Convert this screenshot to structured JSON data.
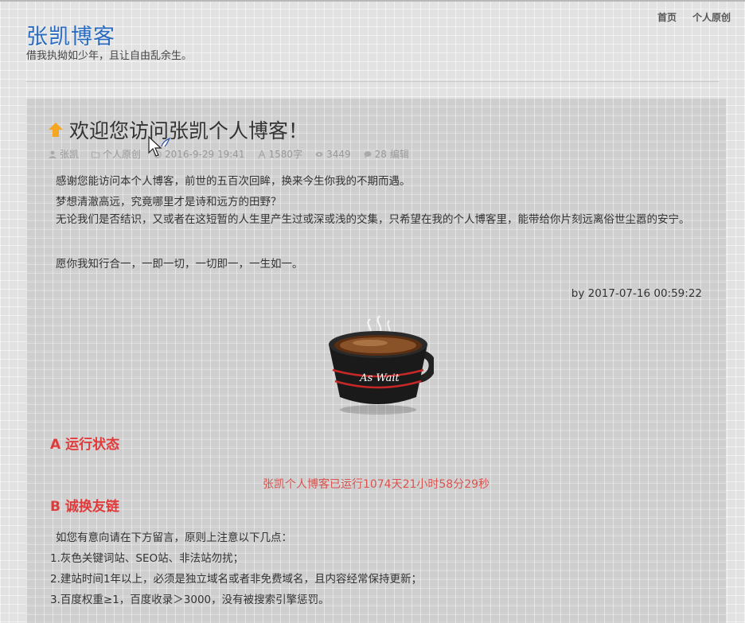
{
  "site": {
    "title": "张凯博客",
    "tagline": "借我执拗如少年，且让自由乱余生。"
  },
  "nav": {
    "items": [
      "首页",
      "个人原创"
    ]
  },
  "post": {
    "title": "欢迎您访问张凯个人博客！",
    "meta": {
      "author": "张凯",
      "category": "个人原创",
      "date": "2016-9-29 19:41",
      "words": "1580字",
      "views": "3449",
      "comments": "28",
      "edit": "编辑"
    },
    "paragraphs": [
      "感谢您能访问本个人博客，前世的五百次回眸，换来今生你我的不期而遇。",
      "梦想清澈高远，究竟哪里才是诗和远方的田野？",
      "无论我们是否结识，又或者在这短暂的人生里产生过或深或浅的交集，只希望在我的个人博客里，能带给你片刻远离俗世尘嚣的安宁。",
      "愿你我知行合一，一即一切，一切即一，一生如一。"
    ],
    "byline": "by 2017-07-16 00:59:22",
    "cup_text": "As Wait"
  },
  "section_a": {
    "heading": "A 运行状态",
    "runtime": "张凯个人博客已运行1074天21小时58分29秒"
  },
  "section_b": {
    "heading": "B 诚换友链",
    "intro": "如您有意向请在下方留言，原则上注意以下几点：",
    "rules": [
      "1.灰色关键词站、SEO站、非法站勿扰；",
      "2.建站时间1年以上，必须是独立域名或者非免费域名，且内容经常保持更新；",
      "3.百度权重≥1，百度收录＞3000，没有被搜索引擎惩罚。"
    ]
  },
  "colors": {
    "title_blue": "#2a6bbf",
    "heading_red": "#e03a3a",
    "runtime_red": "#d9534f",
    "accent_orange": "#f5a623"
  }
}
